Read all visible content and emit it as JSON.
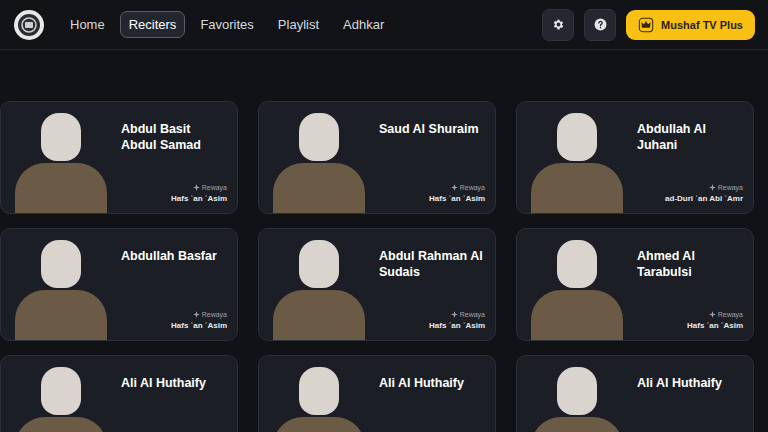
{
  "nav": {
    "items": [
      {
        "label": "Home",
        "selected": false
      },
      {
        "label": "Reciters",
        "selected": true
      },
      {
        "label": "Favorites",
        "selected": false
      },
      {
        "label": "Playlist",
        "selected": false
      },
      {
        "label": "Adhkar",
        "selected": false
      }
    ]
  },
  "upgrade_button": {
    "label": "Mushaf TV Plus"
  },
  "reciters": [
    {
      "name": "Abdul Basit Abdul Samad",
      "rewaya_label": "Rewaya",
      "rewaya": "Hafs ʿan ʿAsim"
    },
    {
      "name": "Saud Al Shuraim",
      "rewaya_label": "Rewaya",
      "rewaya": "Hafs ʿan ʿAsim"
    },
    {
      "name": "Abdullah Al Juhani",
      "rewaya_label": "Rewaya",
      "rewaya": "ad-Duri ʿan Abi ʿAmr"
    },
    {
      "name": "Abdullah Basfar",
      "rewaya_label": "Rewaya",
      "rewaya": "Hafs ʿan ʿAsim"
    },
    {
      "name": "Abdul Rahman Al Sudais",
      "rewaya_label": "Rewaya",
      "rewaya": "Hafs ʿan ʿAsim"
    },
    {
      "name": "Ahmed Al Tarabulsi",
      "rewaya_label": "Rewaya",
      "rewaya": "Hafs ʿan ʿAsim"
    },
    {
      "name": "Ali Al Huthaify"
    },
    {
      "name": "Ali Al Huthaify"
    },
    {
      "name": "Ali Al Huthaify"
    }
  ]
}
